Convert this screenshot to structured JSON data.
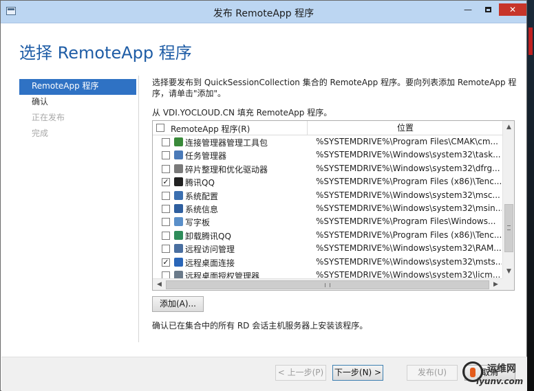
{
  "window": {
    "title": "发布 RemoteApp 程序",
    "minimize": "—",
    "close": "✕"
  },
  "heading": "选择 RemoteApp 程序",
  "nav": [
    {
      "label": "RemoteApp 程序",
      "state": "active"
    },
    {
      "label": "确认",
      "state": "normal"
    },
    {
      "label": "正在发布",
      "state": "disabled"
    },
    {
      "label": "完成",
      "state": "disabled"
    }
  ],
  "description": "选择要发布到 QuickSessionCollection 集合的 RemoteApp 程序。要向列表添加 RemoteApp 程序，请单击\"添加\"。",
  "from_label": "从 VDI.YOCLOUD.CN 填充 RemoteApp 程序。",
  "list": {
    "col_name": "RemoteApp 程序(R)",
    "col_location": "位置",
    "rows": [
      {
        "checked": false,
        "name": "连接管理器管理工具包",
        "path": "%SYSTEMDRIVE%\\Program Files\\CMAK\\cm...",
        "icon": "cmak-icon",
        "color": "#3a8a3a"
      },
      {
        "checked": false,
        "name": "任务管理器",
        "path": "%SYSTEMDRIVE%\\Windows\\system32\\task...",
        "icon": "task-manager-icon",
        "color": "#4a7ab8"
      },
      {
        "checked": false,
        "name": "碎片整理和优化驱动器",
        "path": "%SYSTEMDRIVE%\\Windows\\system32\\dfrg...",
        "icon": "defrag-icon",
        "color": "#7a7a7a"
      },
      {
        "checked": true,
        "name": "腾讯QQ",
        "path": "%SYSTEMDRIVE%\\Program Files (x86)\\Tenc...",
        "icon": "qq-penguin-icon",
        "color": "#222222"
      },
      {
        "checked": false,
        "name": "系统配置",
        "path": "%SYSTEMDRIVE%\\Windows\\system32\\msc...",
        "icon": "system-config-icon",
        "color": "#3b6fb0"
      },
      {
        "checked": false,
        "name": "系统信息",
        "path": "%SYSTEMDRIVE%\\Windows\\system32\\msin...",
        "icon": "system-info-icon",
        "color": "#2f5f9f"
      },
      {
        "checked": false,
        "name": "写字板",
        "path": "%SYSTEMDRIVE%\\Program Files\\Windows...",
        "icon": "wordpad-icon",
        "color": "#5a8fc9"
      },
      {
        "checked": false,
        "name": "卸载腾讯QQ",
        "path": "%SYSTEMDRIVE%\\Program Files (x86)\\Tenc...",
        "icon": "uninstall-icon",
        "color": "#2e8c5a"
      },
      {
        "checked": false,
        "name": "远程访问管理",
        "path": "%SYSTEMDRIVE%\\Windows\\system32\\RAM...",
        "icon": "remote-access-icon",
        "color": "#4a6fa0"
      },
      {
        "checked": true,
        "name": "远程桌面连接",
        "path": "%SYSTEMDRIVE%\\Windows\\system32\\msts...",
        "icon": "remote-desktop-icon",
        "color": "#2a66b8"
      },
      {
        "checked": false,
        "name": "远程桌面授权管理器",
        "path": "%SYSTEMDRIVE%\\Windows\\system32\\licm...",
        "icon": "license-manager-icon",
        "color": "#6a7a8a"
      }
    ]
  },
  "add_button": "添加(A)...",
  "confirm_note": "确认已在集合中的所有 RD 会话主机服务器上安装该程序。",
  "footer": {
    "prev": "< 上一步(P)",
    "next": "下一步(N) >",
    "publish": "发布(U)",
    "cancel": "取消"
  },
  "watermark": {
    "line1": "运维网",
    "line2": "iyunv.com"
  }
}
